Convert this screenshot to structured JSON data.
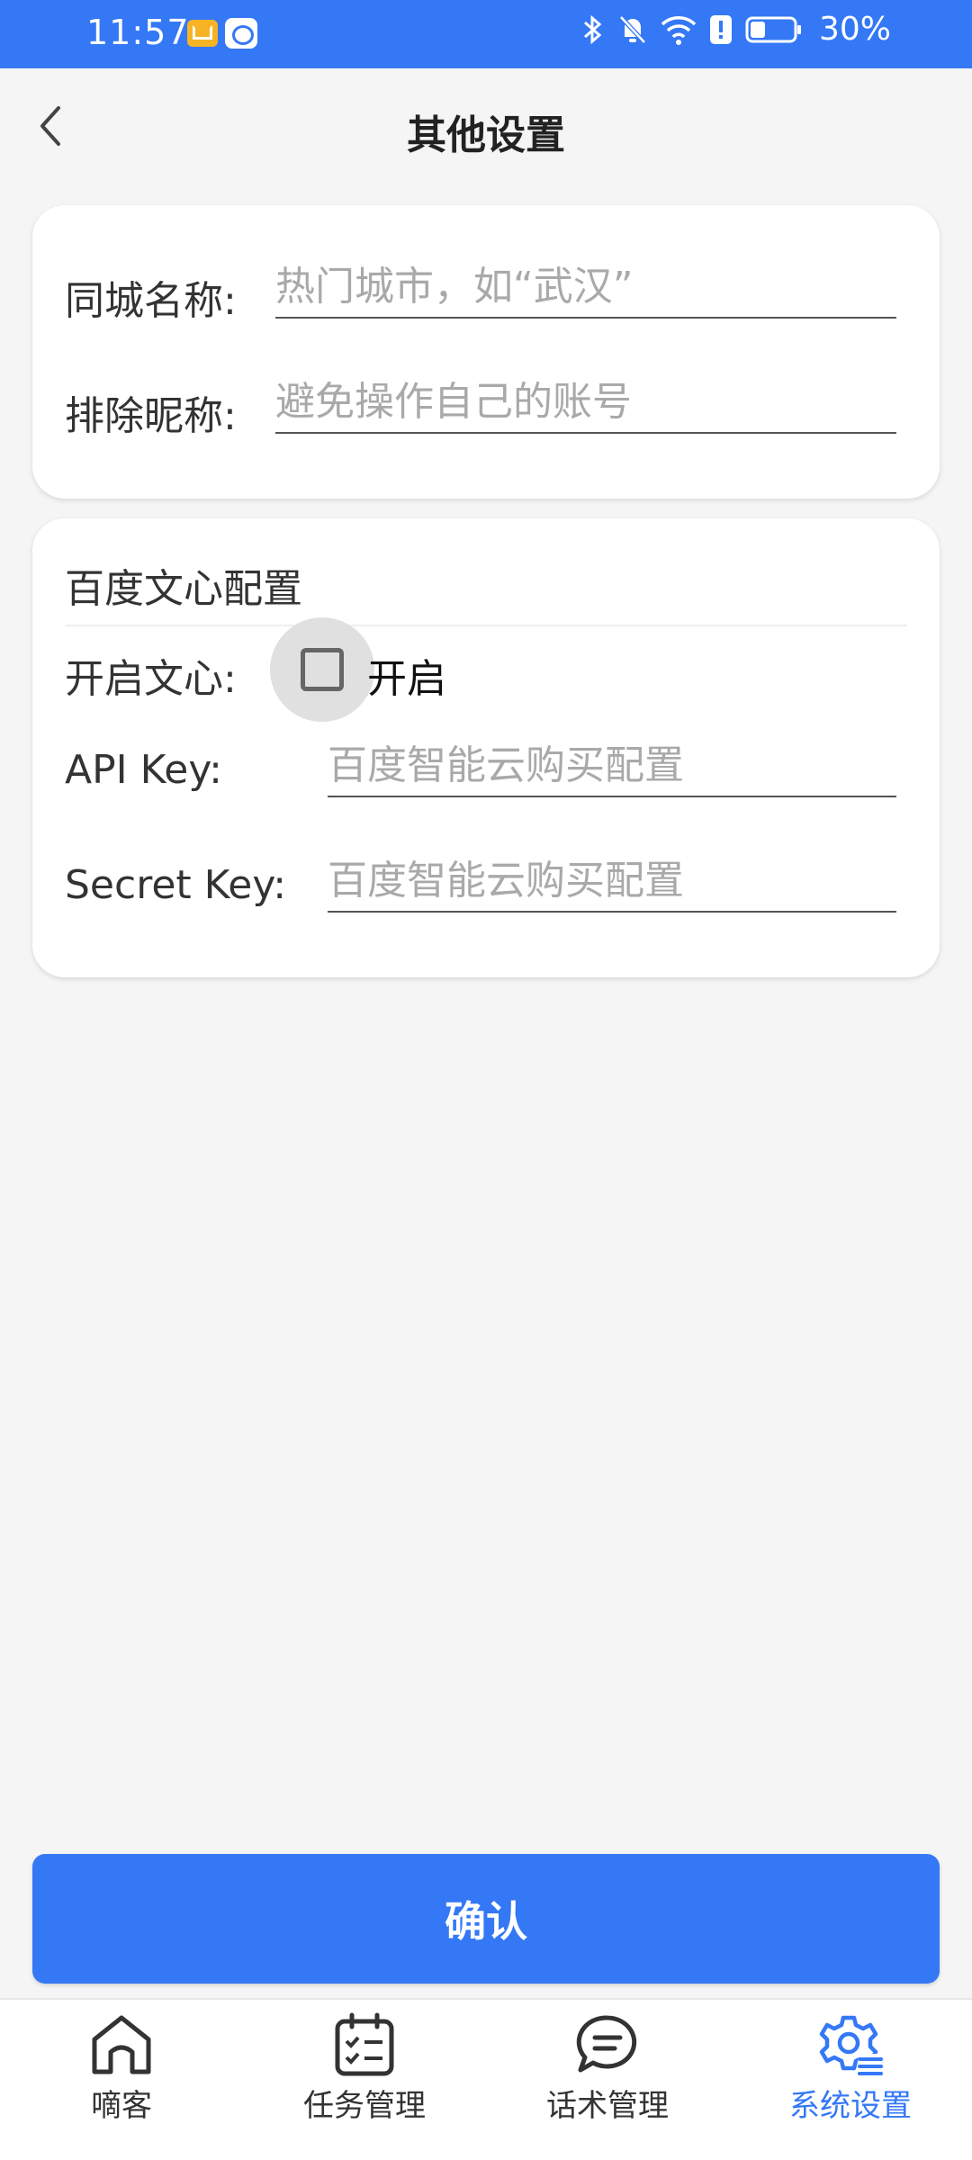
{
  "status_bar": {
    "time": "11:57",
    "battery": "30%",
    "icons": [
      "mail-notification-icon",
      "chat-notification-icon",
      "bluetooth-icon",
      "bell-off-icon",
      "wifi-icon",
      "alert-icon",
      "battery-icon"
    ]
  },
  "header": {
    "title": "其他设置",
    "back_icon": "chevron-left-icon"
  },
  "form": {
    "city_name": {
      "label": "同城名称:",
      "value": "",
      "placeholder": "热门城市，如“武汉”"
    },
    "exclude_nickname": {
      "label": "排除昵称:",
      "value": "",
      "placeholder": "避免操作自己的账号"
    }
  },
  "wenxin": {
    "section_title": "百度文心配置",
    "enable_label": "开启文心:",
    "enable_checkbox_text": "开启",
    "enabled": false,
    "api_key": {
      "label": "API Key:",
      "value": "",
      "placeholder": "百度智能云购买配置"
    },
    "secret_key": {
      "label": "Secret Key:",
      "value": "",
      "placeholder": "百度智能云购买配置"
    }
  },
  "confirm_label": "确认",
  "tabs": [
    {
      "label": "嘀客",
      "icon": "home-icon",
      "active": false
    },
    {
      "label": "任务管理",
      "icon": "task-calendar-icon",
      "active": false
    },
    {
      "label": "话术管理",
      "icon": "speech-bubble-icon",
      "active": false
    },
    {
      "label": "系统设置",
      "icon": "settings-gear-icon",
      "active": true
    }
  ],
  "colors": {
    "accent": "#3478f6",
    "background": "#f5f5f5",
    "card": "#ffffff"
  }
}
